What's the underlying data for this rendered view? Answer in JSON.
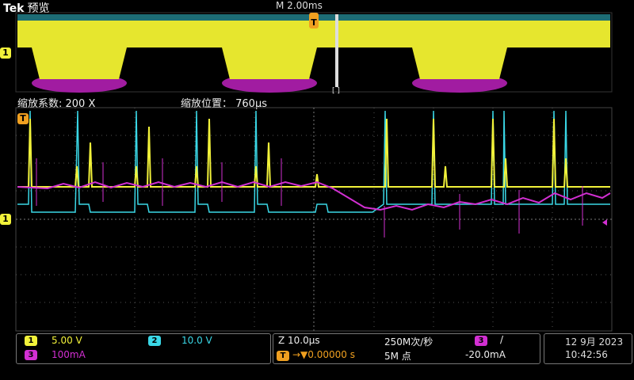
{
  "header": {
    "brand": "Tek",
    "mode": "预览",
    "main_timebase": "M 2.00ms"
  },
  "zoom": {
    "factor_label": "缩放系数: 200 X",
    "position_label": "缩放位置： 760µs"
  },
  "markers": {
    "trigger": "T",
    "ch1": "1",
    "window_bracket": "[ ]"
  },
  "channels": [
    {
      "num": "1",
      "scale": "5.00 V",
      "color": "#f2f23a"
    },
    {
      "num": "2",
      "scale": "10.0 V",
      "color": "#3ad7e6"
    },
    {
      "num": "3",
      "scale": "100mA",
      "color": "#d22fd2"
    }
  ],
  "timebase": {
    "zoom": "Z 10.0µs",
    "delay": "0.00000 s",
    "rate": "250M次/秒",
    "points": "5M 点"
  },
  "trigger": {
    "source": "3",
    "slope": "/",
    "level": "-20.0mA"
  },
  "clock": {
    "date": "12 9月 2023",
    "time": "10:42:56"
  }
}
